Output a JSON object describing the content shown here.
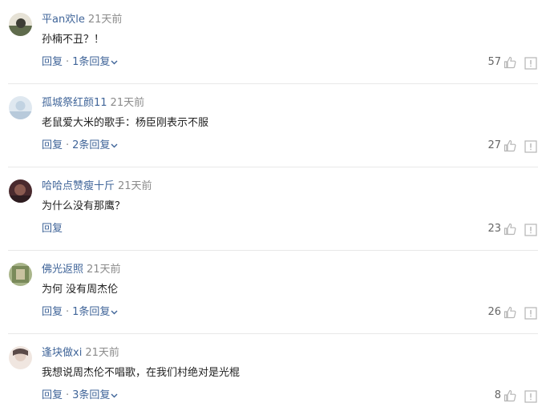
{
  "comments": [
    {
      "username": "平an欢le",
      "time": "21天前",
      "text": "孙楠不丑？！",
      "reply_label": "回复",
      "reply_count": "1条回复",
      "likes": "57",
      "avatar_color": "#5f6b4c"
    },
    {
      "username": "孤城祭红颜11",
      "time": "21天前",
      "text": "老鼠爱大米的歌手：杨臣刚表示不服",
      "reply_label": "回复",
      "reply_count": "2条回复",
      "likes": "27",
      "avatar_color": "#c9d8e6"
    },
    {
      "username": "哈哈点赞瘦十斤",
      "time": "21天前",
      "text": "为什么没有那鹰？",
      "reply_label": "回复",
      "reply_count": "",
      "likes": "23",
      "avatar_color": "#6b3a3a"
    },
    {
      "username": "佛光返照",
      "time": "21天前",
      "text": "为何 没有周杰伦",
      "reply_label": "回复",
      "reply_count": "1条回复",
      "likes": "26",
      "avatar_color": "#7a8a5a"
    },
    {
      "username": "逢块做xi",
      "time": "21天前",
      "text": "我想说周杰伦不唱歌，在我们村绝对是光棍",
      "reply_label": "回复",
      "reply_count": "3条回复",
      "likes": "8",
      "avatar_color": "#d8c8c0"
    }
  ],
  "separator": "·",
  "icons": {
    "like": "thumb-up-icon",
    "report": "report-icon",
    "expand": "chevron-down-icon"
  },
  "colors": {
    "username": "#406599",
    "link": "#406599",
    "time": "#8b8b8b",
    "icon": "#b5b5b5"
  }
}
